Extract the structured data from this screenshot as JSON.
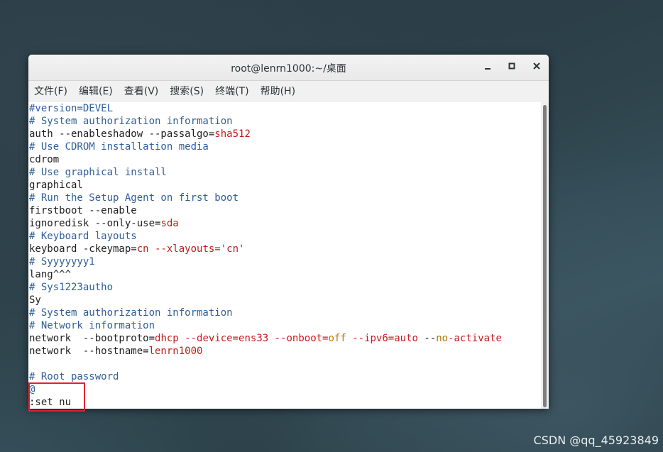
{
  "window": {
    "title": "root@lenrn1000:~/桌面",
    "minimize_icon": "minimize-icon",
    "maximize_icon": "maximize-icon",
    "close_icon": "close-icon"
  },
  "menu": [
    {
      "label": "文件(F)"
    },
    {
      "label": "编辑(E)"
    },
    {
      "label": "查看(V)"
    },
    {
      "label": "搜索(S)"
    },
    {
      "label": "终端(T)"
    },
    {
      "label": "帮助(H)"
    }
  ],
  "terminal": {
    "lines": [
      [
        {
          "t": "#version=DEVEL",
          "c": "c"
        }
      ],
      [
        {
          "t": "# System authorization information",
          "c": "c"
        }
      ],
      [
        {
          "t": "auth --enableshadow --passalgo="
        },
        {
          "t": "sha512",
          "c": "r"
        }
      ],
      [
        {
          "t": "# Use CDROM installation media",
          "c": "c"
        }
      ],
      [
        {
          "t": "cdrom"
        }
      ],
      [
        {
          "t": "# Use graphical install",
          "c": "c"
        }
      ],
      [
        {
          "t": "graphical"
        }
      ],
      [
        {
          "t": "# Run the Setup Agent on first boot",
          "c": "c"
        }
      ],
      [
        {
          "t": "firstboot --enable"
        }
      ],
      [
        {
          "t": "ignoredisk --only-use="
        },
        {
          "t": "sda",
          "c": "r"
        }
      ],
      [
        {
          "t": "# Keyboard layouts",
          "c": "c"
        }
      ],
      [
        {
          "t": "keyboard -ckeymap="
        },
        {
          "t": "cn",
          "c": "r"
        },
        {
          "t": " "
        },
        {
          "t": "--xlayouts='cn'",
          "c": "r"
        }
      ],
      [
        {
          "t": "# Syyyyyyy1",
          "c": "c"
        }
      ],
      [
        {
          "t": "lang^^^"
        }
      ],
      [
        {
          "t": "# Sys1223autho",
          "c": "c"
        }
      ],
      [
        {
          "t": "Sy"
        }
      ],
      [
        {
          "t": "# System authorization information",
          "c": "c"
        }
      ],
      [
        {
          "t": "# Network information",
          "c": "c"
        }
      ],
      [
        {
          "t": "network  --bootproto="
        },
        {
          "t": "dhcp",
          "c": "r"
        },
        {
          "t": " "
        },
        {
          "t": "--device=ens33",
          "c": "r"
        },
        {
          "t": " "
        },
        {
          "t": "--onboot=",
          "c": "r"
        },
        {
          "t": "off",
          "c": "o"
        },
        {
          "t": " "
        },
        {
          "t": "--ipv6=auto",
          "c": "r"
        },
        {
          "t": " --"
        },
        {
          "t": "no",
          "c": "o"
        },
        {
          "t": "-activate",
          "c": "r"
        }
      ],
      [
        {
          "t": "network  --hostname="
        },
        {
          "t": "lenrn1000",
          "c": "r"
        }
      ],
      [
        {
          "t": ""
        }
      ],
      [
        {
          "t": "# Root password",
          "c": "c"
        }
      ],
      [
        {
          "t": "@",
          "c": "c"
        }
      ],
      [
        {
          "t": ":set nu"
        }
      ]
    ]
  },
  "watermark": "CSDN @qq_45923849"
}
